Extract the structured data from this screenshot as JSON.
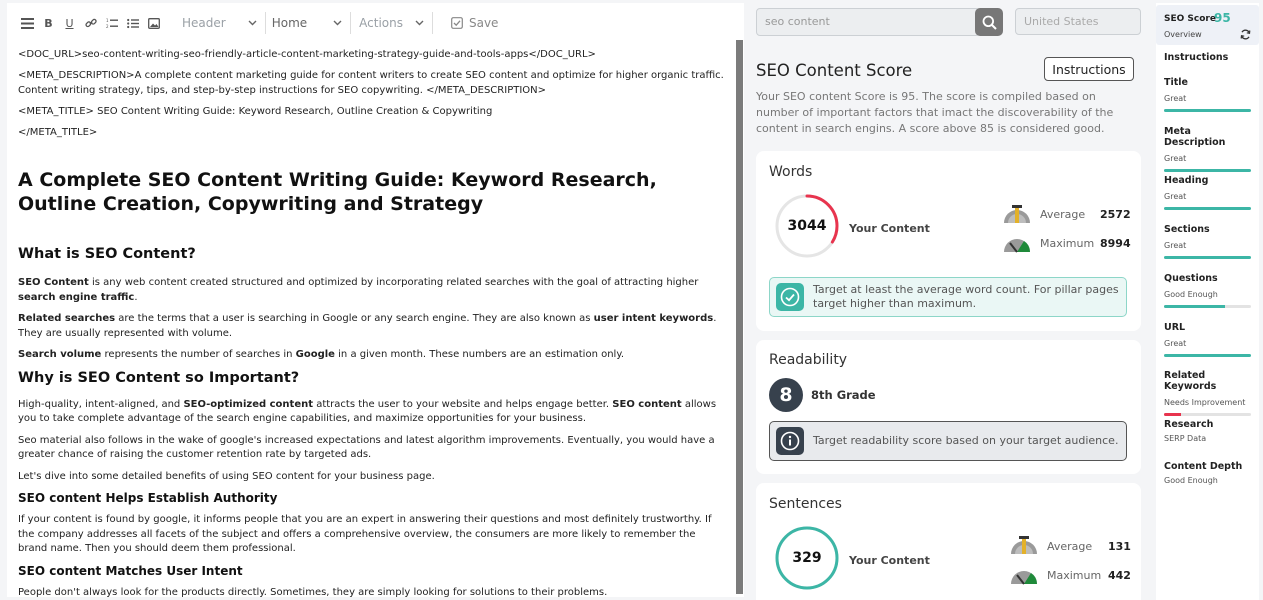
{
  "toolbar": {
    "header_select": "Header",
    "home_select": "Home",
    "actions_select": "Actions",
    "save_label": "Save"
  },
  "doc": {
    "doc_url": "<DOC_URL>seo-content-writing-seo-friendly-article-content-marketing-strategy-guide-and-tools-apps</DOC_URL>",
    "meta_description": "<META_DESCRIPTION>A complete content marketing guide for content writers to create SEO content and optimize for higher organic traffic. Content writing strategy, tips, and step-by-step instructions for SEO copywriting. </META_DESCRIPTION>",
    "meta_title_open": "<META_TITLE> SEO Content Writing Guide: Keyword Research, Outline Creation & Copywriting",
    "meta_title_close": "</META_TITLE>",
    "h1": "A Complete SEO Content Writing Guide: Keyword Research, Outline Creation, Copywriting and Strategy",
    "h2_what": "What is SEO Content?",
    "p1_b1": "SEO Content",
    "p1_t1": " is any web content created structured and optimized by incorporating related searches with the goal of attracting higher ",
    "p1_b2": "search engine traffic",
    "p1_t2": ".",
    "p2_b1": "Related searches",
    "p2_t1": " are the terms that a user is searching in Google or any search engine. They are also known as ",
    "p2_b2": "user intent keywords",
    "p2_t2": ". They are usually represented with volume.",
    "p3_b1": "Search volume",
    "p3_t1": " represents the number of searches in ",
    "p3_b2": "Google",
    "p3_t2": " in a given month. These numbers are an estimation only.",
    "h2_why": "Why is SEO Content so Important?",
    "p4_t0": "High-quality, intent-aligned, and ",
    "p4_b1": "SEO-optimized content",
    "p4_t1": " attracts the user to your website and helps engage better. ",
    "p4_b2": "SEO content",
    "p4_t2": " allows you to take complete advantage of the search engine capabilities, and maximize opportunities for your business.",
    "p5": "Seo material also follows in the wake of google's increased expectations and latest algorithm improvements. Eventually, you would have a greater chance of raising the customer retention rate by targeted ads.",
    "p6": "Let's dive into some detailed benefits of using SEO content for your business page.",
    "h3_auth": "SEO content Helps Establish Authority",
    "p7": "If your content is found by google, it informs people that you are an expert in answering their questions and most definitely trustworthy. If the company addresses all facets of the subject and offers a comprehensive overview, the consumers are more likely to remember the brand name. Then you should deem them professional.",
    "h3_intent": "SEO content Matches User Intent",
    "p8": "People don't always look for the products directly. Sometimes, they are simply looking for solutions to their problems."
  },
  "search": {
    "value": "seo content",
    "country": "United States"
  },
  "score_panel": {
    "title": "SEO Content Score",
    "instructions_label": "Instructions",
    "description": "Your SEO content Score is 95. The score is compiled based on number of important factors that imact the discoverability of the content in search engins. A score above 85 is considered good."
  },
  "words": {
    "title": "Words",
    "value": "3044",
    "your_content": "Your Content",
    "average_label": "Average",
    "average_value": "2572",
    "maximum_label": "Maximum",
    "maximum_value": "8994",
    "progress": 0.339,
    "tip": "Target at least the average word count. For pillar pages target higher than maximum."
  },
  "readability": {
    "title": "Readability",
    "grade_number": "8",
    "grade_label": "8th Grade",
    "tip": "Target readability score based on your target audience."
  },
  "sentences": {
    "title": "Sentences",
    "value": "329",
    "your_content": "Your Content",
    "average_label": "Average",
    "average_value": "131",
    "maximum_label": "Maximum",
    "maximum_value": "442",
    "progress": 1.0
  },
  "colors": {
    "accent": "#3cb6a6",
    "alert": "#e8344e",
    "dark": "#37414d"
  },
  "sidebar": {
    "header_title": "SEO Score",
    "header_score": "95",
    "header_sub": "Overview",
    "items": [
      {
        "name": "Instructions",
        "status": "",
        "progress": null,
        "color": ""
      },
      {
        "name": "Title",
        "status": "Great",
        "progress": 1.0,
        "color": "#3cb6a6"
      },
      {
        "name": "Meta Description",
        "status": "Great",
        "progress": 1.0,
        "color": "#3cb6a6"
      },
      {
        "name": "Heading",
        "status": "Great",
        "progress": 1.0,
        "color": "#3cb6a6"
      },
      {
        "name": "Sections",
        "status": "Great",
        "progress": 1.0,
        "color": "#3cb6a6"
      },
      {
        "name": "Questions",
        "status": "Good Enough",
        "progress": 0.7,
        "color": "#3cb6a6"
      },
      {
        "name": "URL",
        "status": "Great",
        "progress": 1.0,
        "color": "#3cb6a6"
      },
      {
        "name": "Related Keywords",
        "status": "Needs Improvement",
        "progress": 0.2,
        "color": "#e8344e"
      },
      {
        "name": "Research",
        "status": "SERP Data",
        "progress": null,
        "color": ""
      },
      {
        "name": "Content Depth",
        "status": "Good Enough",
        "progress": null,
        "color": ""
      }
    ]
  }
}
